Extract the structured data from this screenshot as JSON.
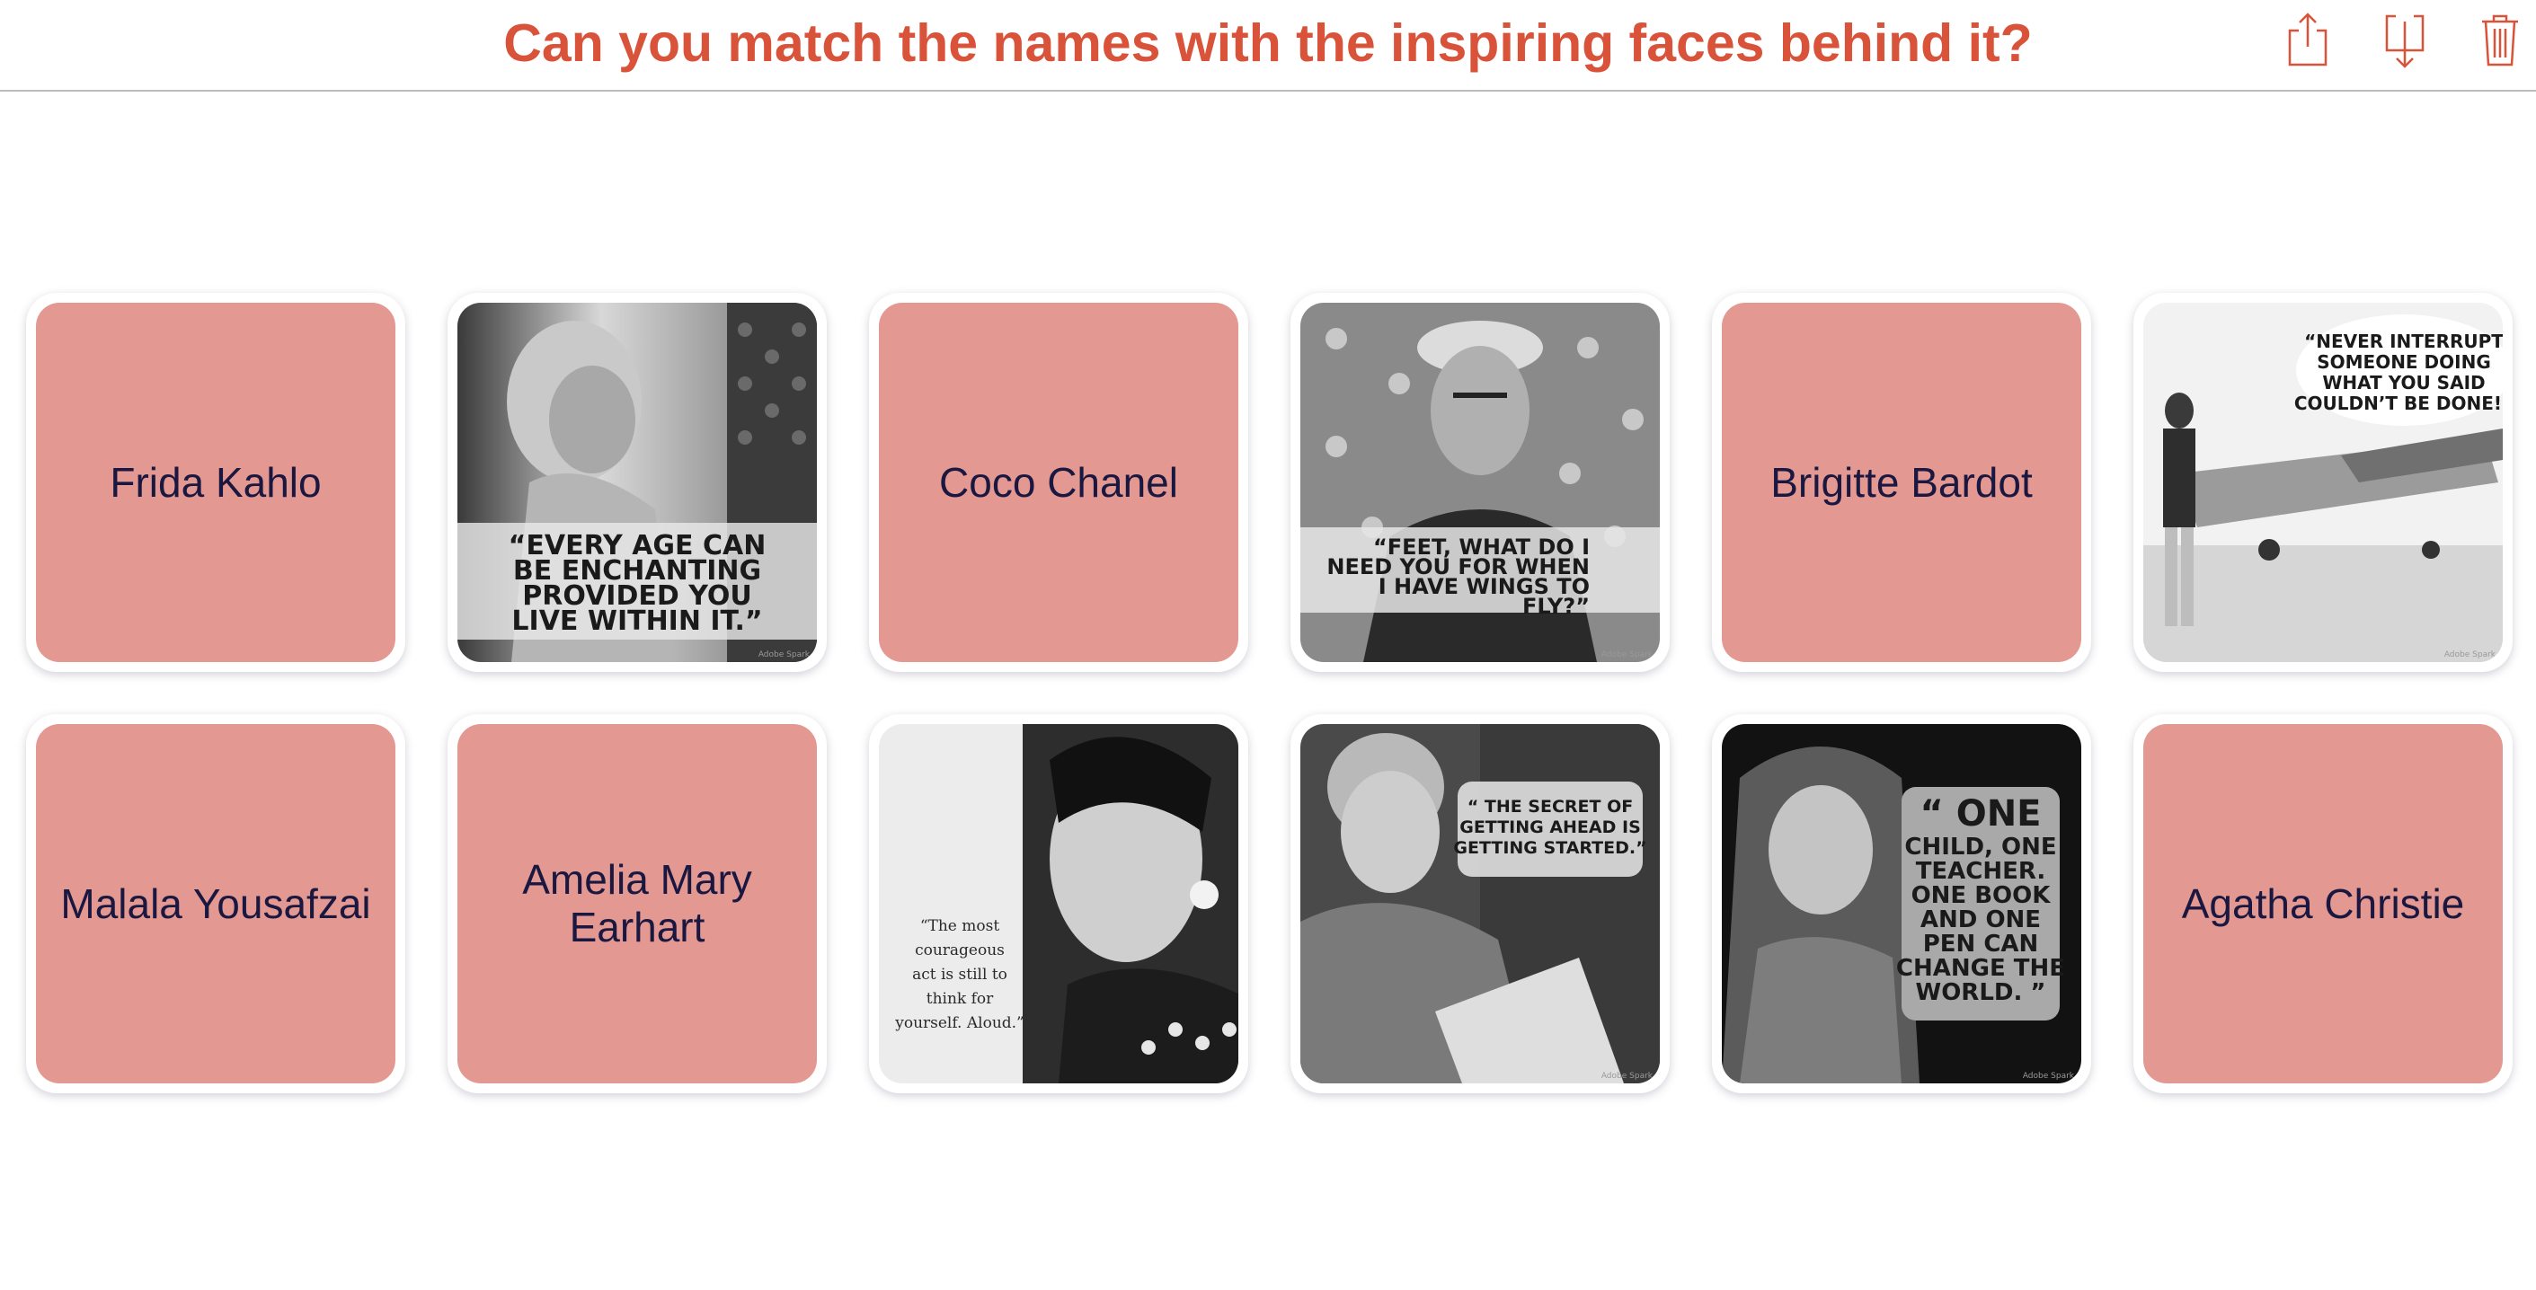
{
  "header": {
    "title": "Can you match the names with the inspiring faces behind it?",
    "title_color": "#d9533b"
  },
  "toolbar": {
    "icons": [
      "share-icon",
      "download-icon",
      "trash-icon"
    ]
  },
  "cards": {
    "frida_kahlo": "Frida Kahlo",
    "coco_chanel": "Coco Chanel",
    "brigitte_bardot": "Brigitte Bardot",
    "malala_yousafzai": "Malala Yousafzai",
    "amelia_earhart": "Amelia Mary Earhart",
    "agatha_christie": "Agatha Christie",
    "name_card_color": "#e39891"
  },
  "quotes": {
    "bardot": [
      "“EVERY AGE CAN",
      "BE ENCHANTING",
      "PROVIDED YOU",
      "LIVE WITHIN IT.”"
    ],
    "kahlo": [
      "“FEET, WHAT DO I",
      "NEED YOU FOR WHEN",
      "I HAVE WINGS TO",
      "FLY?”"
    ],
    "earhart": [
      "“NEVER INTERRUPT",
      "SOMEONE DOING",
      "WHAT YOU SAID",
      "COULDN’T BE DONE!”"
    ],
    "chanel": [
      "“The most",
      "courageous",
      "act is still to",
      "think for",
      "yourself. Aloud.”"
    ],
    "christie": [
      "“ THE SECRET OF",
      "GETTING AHEAD IS",
      "GETTING STARTED.”"
    ],
    "malala": [
      "“ ONE",
      "CHILD, ONE",
      "TEACHER.",
      "ONE BOOK",
      "AND ONE",
      "PEN CAN",
      "CHANGE THE",
      "WORLD. ”"
    ]
  },
  "watermark": "Adobe Spark"
}
